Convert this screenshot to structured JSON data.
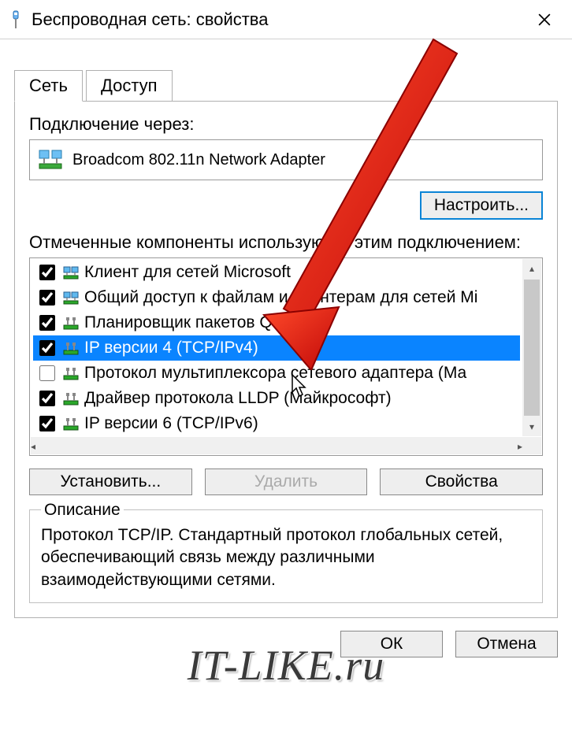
{
  "window": {
    "title": "Беспроводная сеть: свойства"
  },
  "tabs": {
    "network": "Сеть",
    "access": "Доступ"
  },
  "connect_via": {
    "label": "Подключение через:",
    "adapter": "Broadcom 802.11n Network Adapter"
  },
  "configure_btn": "Настроить...",
  "components": {
    "label": "Отмеченные компоненты используются этим подключением:",
    "items": [
      {
        "checked": true,
        "icon": "client",
        "label": "Клиент для сетей Microsoft"
      },
      {
        "checked": true,
        "icon": "client",
        "label": "Общий доступ к файлам и принтерам для сетей Mi"
      },
      {
        "checked": true,
        "icon": "protocol",
        "label": "Планировщик пакетов QoS"
      },
      {
        "checked": true,
        "icon": "protocol",
        "label": "IP версии 4 (TCP/IPv4)",
        "selected": true
      },
      {
        "checked": false,
        "icon": "protocol",
        "label": "Протокол мультиплексора сетевого адаптера (Ма"
      },
      {
        "checked": true,
        "icon": "protocol",
        "label": "Драйвер протокола LLDP (Майкрософт)"
      },
      {
        "checked": true,
        "icon": "protocol",
        "label": "IP версии 6 (TCP/IPv6)"
      }
    ]
  },
  "buttons": {
    "install": "Установить...",
    "remove": "Удалить",
    "properties": "Свойства",
    "ok": "ОК",
    "cancel": "Отмена"
  },
  "description": {
    "legend": "Описание",
    "text": "Протокол TCP/IP. Стандартный протокол глобальных сетей, обеспечивающий связь между различными взаимодействующими сетями."
  },
  "watermark": "IT-LIKE.ru",
  "colors": {
    "selection": "#0a84ff",
    "accent_border": "#0a84d6",
    "arrow": "#e21b1b"
  }
}
